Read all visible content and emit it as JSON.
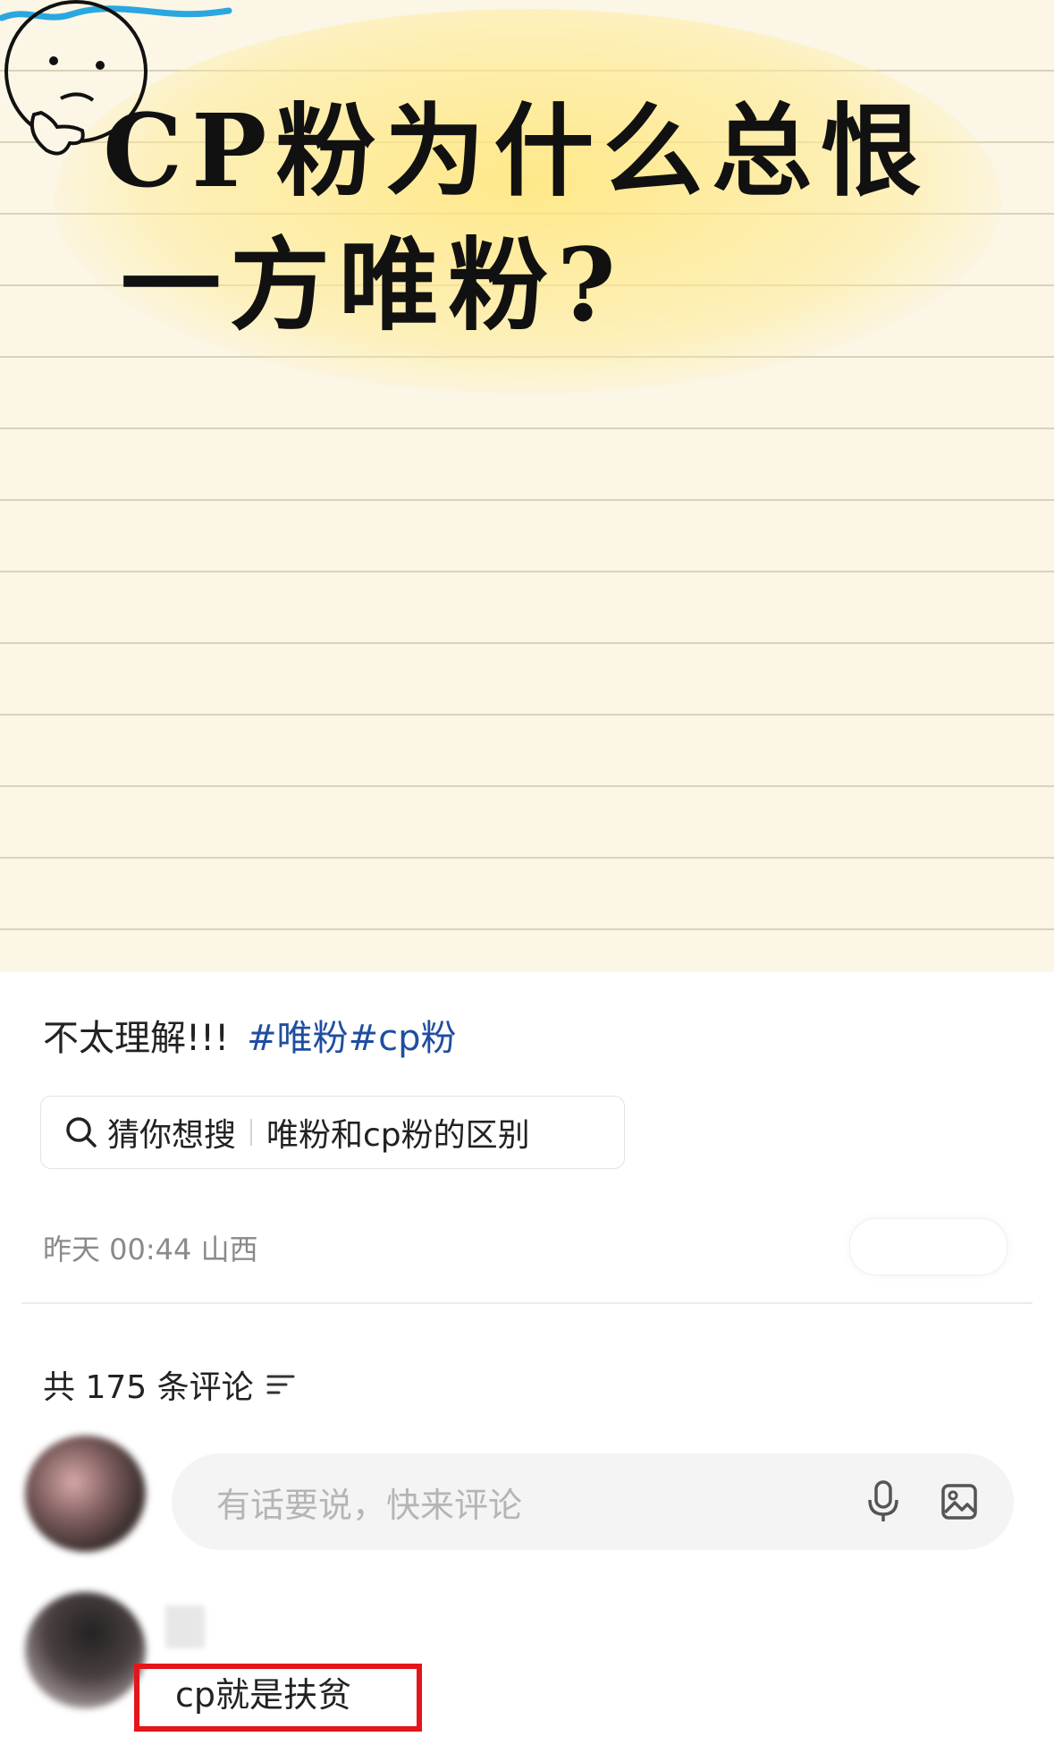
{
  "cover": {
    "line1": "CP粉为什么总恨",
    "line2": "一方唯粉?"
  },
  "caption": {
    "text": "不太理解!!!",
    "tags": "#唯粉#cp粉"
  },
  "guess_search": {
    "label": "猜你想搜",
    "query": "唯粉和cp粉的区别"
  },
  "meta": {
    "time_location": "昨天 00:44 山西"
  },
  "comments": {
    "count_label": "共 175 条评论",
    "input_placeholder": "有话要说，快来评论",
    "items": [
      {
        "text": "cp就是扶贫"
      }
    ]
  },
  "colors": {
    "tag_blue": "#1f4ea0",
    "highlight_red": "#e3161b",
    "paper": "#fbf6e6"
  },
  "icons": {
    "search": "search-icon",
    "sort": "sort-icon",
    "mic": "microphone-icon",
    "image": "image-icon",
    "thinking_face": "thinking-face-icon"
  }
}
